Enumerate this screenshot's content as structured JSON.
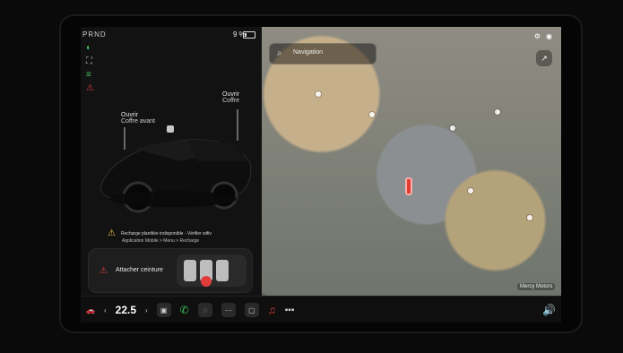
{
  "status": {
    "gear": "PRND",
    "battery_percent": "9 %"
  },
  "vehicle": {
    "frunk_open_label": "Ouvrir",
    "frunk_label": "Coffre avant",
    "trunk_open_label": "Ouvrir",
    "trunk_label": "Coffre"
  },
  "alerts": {
    "charging_line1": "Recharge planifiée indisponible - Vérifier wifiv",
    "charging_line2": "Application Mobile > Menu > Recharge",
    "seatbelt": "Attacher ceinture"
  },
  "navigation": {
    "search_placeholder": "Navigation",
    "map_bottom_badge": "Mercy Motors"
  },
  "climate": {
    "temperature": "22.5"
  },
  "icons": {
    "headlight": "headlight-icon",
    "fog": "fog-icon",
    "drl": "drl-icon",
    "seatbelt_alert": "seatbelt-alert-icon",
    "navigation": "search-icon",
    "car_bottom": "car-icon",
    "phone": "phone-icon",
    "music": "music-icon",
    "volume": "volume-icon"
  },
  "colors": {
    "accent_green": "#3cc35d",
    "alert_red": "#e23b3b",
    "warning_yellow": "#f2c94c"
  }
}
